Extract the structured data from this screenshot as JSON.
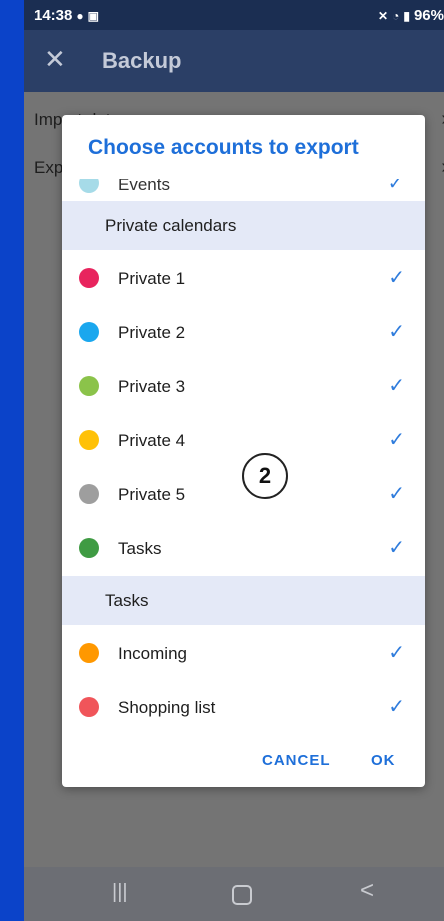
{
  "status_bar": {
    "time": "14:38",
    "battery": "96%"
  },
  "appbar": {
    "title": "Backup",
    "close_icon": "close-icon"
  },
  "background_rows": [
    {
      "label": "Import data"
    },
    {
      "label": "Export data"
    }
  ],
  "dialog": {
    "title": "Choose accounts to export",
    "partial_item": {
      "label": "Events",
      "color": "#a6dbe8"
    },
    "sections": [
      {
        "header": "Private calendars",
        "items": [
          {
            "label": "Private 1",
            "color": "#e8245e",
            "checked": true
          },
          {
            "label": "Private 2",
            "color": "#1aa7ee",
            "checked": true
          },
          {
            "label": "Private 3",
            "color": "#8bc34a",
            "checked": true
          },
          {
            "label": "Private 4",
            "color": "#ffc107",
            "checked": true
          },
          {
            "label": "Private 5",
            "color": "#9e9e9e",
            "checked": true
          },
          {
            "label": "Tasks",
            "color": "#3f9b43",
            "checked": true
          }
        ]
      },
      {
        "header": "Tasks",
        "items": [
          {
            "label": "Incoming",
            "color": "#ff9800",
            "checked": true
          },
          {
            "label": "Shopping list",
            "color": "#f0555a",
            "checked": true
          }
        ]
      }
    ],
    "check_glyph": "✓",
    "cancel_label": "CANCEL",
    "ok_label": "OK"
  },
  "annotation": {
    "label": "2"
  },
  "nav": {
    "recents_glyph": "|||",
    "back_glyph": "<"
  }
}
